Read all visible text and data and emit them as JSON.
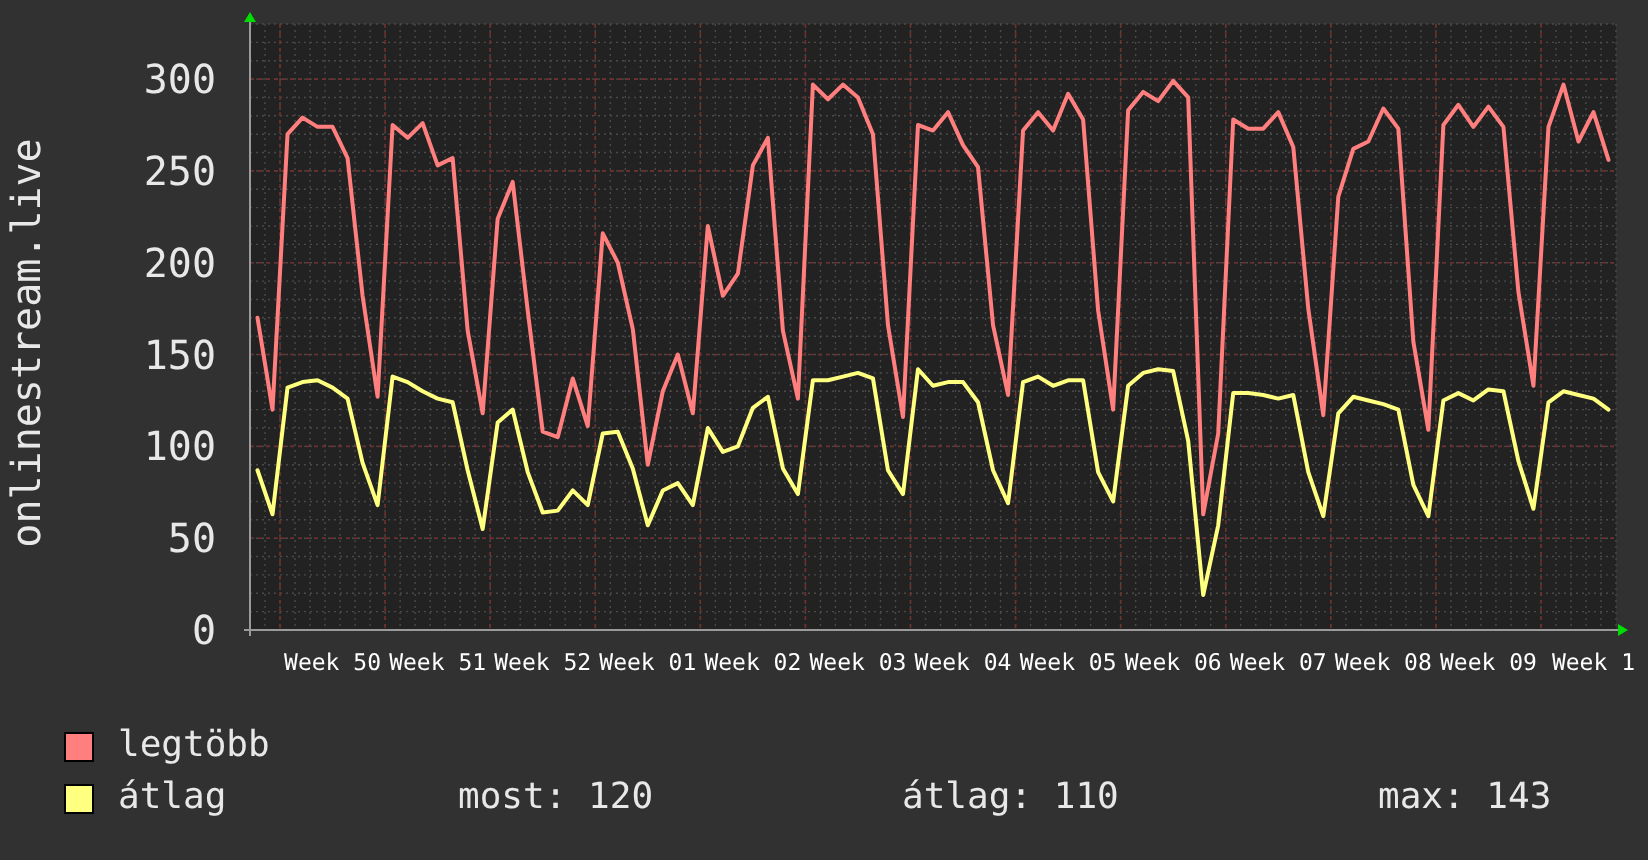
{
  "chart": {
    "chart_data": {
      "type": "line",
      "ylabel": "onlinestream.live",
      "grid": true,
      "ylim": [
        0,
        330
      ],
      "yticks": [
        0,
        50,
        100,
        150,
        200,
        250,
        300
      ],
      "categories": [
        null,
        null,
        null,
        null,
        null,
        "Week 50",
        null,
        null,
        null,
        null,
        null,
        null,
        "Week 51",
        null,
        null,
        null,
        null,
        null,
        null,
        "Week 52",
        null,
        null,
        null,
        null,
        null,
        null,
        "Week 01",
        null,
        null,
        null,
        null,
        null,
        null,
        "Week 02",
        null,
        null,
        null,
        null,
        null,
        null,
        "Week 03",
        null,
        null,
        null,
        null,
        null,
        null,
        "Week 04",
        null,
        null,
        null,
        null,
        null,
        null,
        "Week 05",
        null,
        null,
        null,
        null,
        null,
        null,
        "Week 06",
        null,
        null,
        null,
        null,
        null,
        null,
        "Week 07",
        null,
        null,
        null,
        null,
        null,
        null,
        "Week 08",
        null,
        null,
        null,
        null,
        null,
        null,
        "Week 09",
        null,
        null,
        null,
        null,
        null,
        null,
        "Week 1",
        null
      ],
      "series": [
        {
          "name": "legtöbb",
          "color": "#ff7f7f",
          "values": [
            170,
            120,
            270,
            279,
            274,
            274,
            257,
            182,
            127,
            275,
            268,
            276,
            253,
            257,
            163,
            118,
            224,
            244,
            174,
            108,
            105,
            137,
            111,
            216,
            200,
            164,
            90,
            130,
            150,
            118,
            220,
            182,
            194,
            253,
            268,
            163,
            126,
            297,
            289,
            297,
            290,
            270,
            166,
            116,
            275,
            272,
            282,
            264,
            252,
            166,
            128,
            272,
            282,
            272,
            292,
            278,
            174,
            120,
            283,
            293,
            288,
            299,
            290,
            63,
            107,
            278,
            273,
            273,
            282,
            263,
            175,
            117,
            236,
            262,
            266,
            284,
            273,
            157,
            109,
            275,
            286,
            274,
            285,
            274,
            184,
            133,
            274,
            297,
            266,
            282,
            256
          ]
        },
        {
          "name": "átlag",
          "color": "#ffff80",
          "values": [
            87,
            63,
            132,
            135,
            136,
            132,
            126,
            91,
            68,
            138,
            135,
            130,
            126,
            124,
            87,
            55,
            113,
            120,
            86,
            64,
            65,
            76,
            68,
            107,
            108,
            88,
            57,
            76,
            80,
            68,
            110,
            97,
            100,
            121,
            127,
            88,
            74,
            136,
            136,
            138,
            140,
            137,
            87,
            74,
            142,
            133,
            135,
            135,
            124,
            87,
            69,
            135,
            138,
            133,
            136,
            136,
            86,
            70,
            133,
            140,
            142,
            141,
            103,
            19,
            57,
            129,
            129,
            128,
            126,
            128,
            86,
            62,
            118,
            127,
            125,
            123,
            120,
            79,
            62,
            125,
            129,
            125,
            131,
            130,
            92,
            66,
            124,
            130,
            128,
            126,
            120
          ]
        }
      ]
    }
  },
  "stats": [
    "most: 120",
    "átlag: 110",
    "max: 143"
  ]
}
